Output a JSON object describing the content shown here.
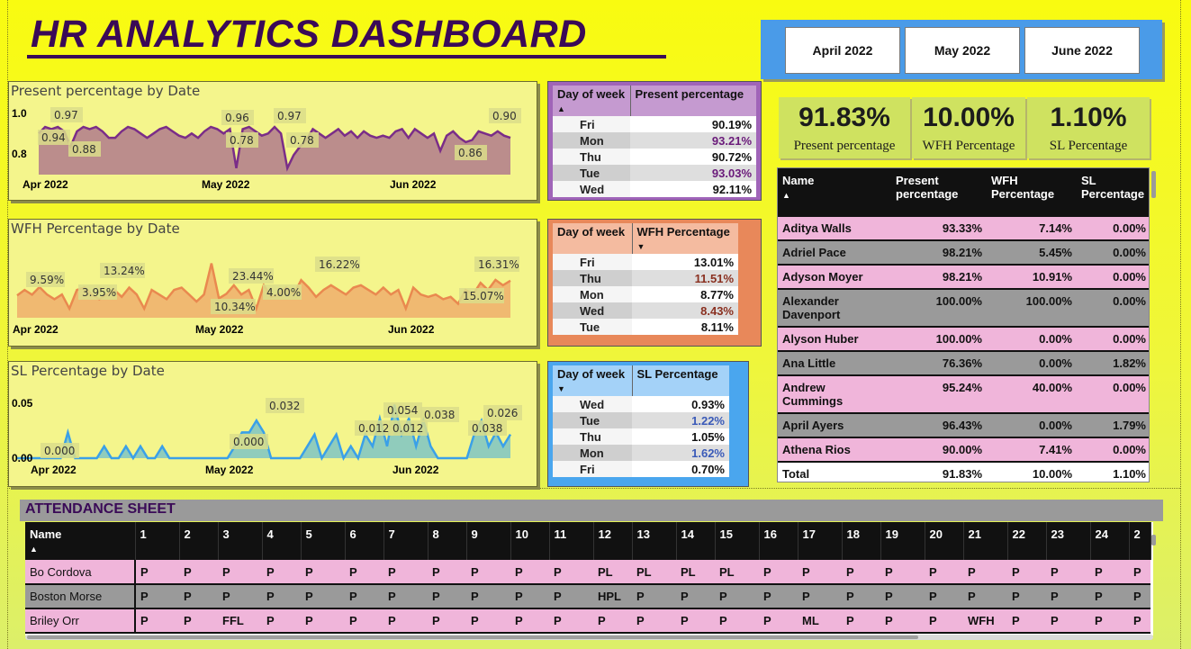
{
  "dashboard_title": "HR ANALYTICS DASHBOARD",
  "colors": {
    "title": "#3a0a57",
    "present_line": "#7a2d88",
    "present_fill": "#b07a8c",
    "wfh_line": "#e9894f",
    "wfh_fill": "#efae6c",
    "sl_line": "#3aa0e8",
    "sl_fill": "#7ec4c4",
    "pink_row": "#f0b5da",
    "grey_row": "#9a9a9a"
  },
  "months": [
    "April 2022",
    "May 2022",
    "June 2022"
  ],
  "kpis": [
    {
      "value": "91.83%",
      "label": "Present percentage"
    },
    {
      "value": "10.00%",
      "label": "WFH Percentage"
    },
    {
      "value": "1.10%",
      "label": "SL Percentage"
    }
  ],
  "chart_data": [
    {
      "type": "area",
      "title": "Present percentage by Date",
      "y_ticks": [
        "1.0",
        "0.8"
      ],
      "x_ticks": [
        "Apr 2022",
        "May 2022",
        "Jun 2022"
      ],
      "ylim": [
        0.75,
        1.02
      ],
      "values": [
        0.94,
        0.97,
        0.96,
        0.97,
        0.95,
        0.88,
        0.95,
        0.97,
        0.96,
        0.97,
        0.95,
        0.92,
        0.92,
        0.95,
        0.97,
        0.96,
        0.94,
        0.92,
        0.94,
        0.96,
        0.97,
        0.95,
        0.93,
        0.92,
        0.94,
        0.92,
        0.95,
        0.97,
        0.96,
        0.94,
        0.96,
        0.78,
        0.96,
        0.97,
        0.95,
        0.93,
        0.94,
        0.97,
        0.94,
        0.78,
        0.84,
        0.88,
        0.91,
        0.96,
        0.94,
        0.92,
        0.94,
        0.96,
        0.93,
        0.95,
        0.92,
        0.95,
        0.93,
        0.92,
        0.93,
        0.92,
        0.95,
        0.96,
        0.92,
        0.96,
        0.94,
        0.92,
        0.94,
        0.86,
        0.93,
        0.95,
        0.92,
        0.9,
        0.91,
        0.95,
        0.94,
        0.93,
        0.95,
        0.93,
        0.92
      ],
      "labels": [
        "0.97",
        "0.94",
        "0.88",
        "0.96",
        "0.78",
        "0.97",
        "0.78",
        "0.90",
        "0.86"
      ]
    },
    {
      "type": "area",
      "title": "WFH Percentage by Date",
      "x_ticks": [
        "Apr 2022",
        "May 2022",
        "Jun 2022"
      ],
      "ylim": [
        0.0,
        0.26
      ],
      "values": [
        0.0959,
        0.12,
        0.0995,
        0.1324,
        0.1,
        0.08,
        0.1,
        0.0395,
        0.12,
        0.13,
        0.1,
        0.08,
        0.1,
        0.12,
        0.09,
        0.13,
        0.1,
        0.0395,
        0.12,
        0.1,
        0.08,
        0.12,
        0.13,
        0.1,
        0.07,
        0.1,
        0.2344,
        0.0834,
        0.1034,
        0.14,
        0.1,
        0.12,
        0.04,
        0.14,
        0.09,
        0.1,
        0.13,
        0.1,
        0.1622,
        0.13,
        0.09,
        0.12,
        0.14,
        0.12,
        0.1,
        0.13,
        0.14,
        0.12,
        0.1,
        0.13,
        0.1,
        0.12,
        0.04,
        0.13,
        0.1,
        0.09,
        0.1,
        0.08,
        0.09,
        0.06,
        0.12,
        0.1,
        0.1507,
        0.12,
        0.1631,
        0.14,
        0.16
      ],
      "labels": [
        "9.59%",
        "3.95%",
        "13.24%",
        "10.34%",
        "23.44%",
        "4.00%",
        "16.22%",
        "16.31%",
        "15.07%"
      ]
    },
    {
      "type": "area",
      "title": "SL Percentage by Date",
      "y_ticks": [
        "0.05",
        "0.00"
      ],
      "x_ticks": [
        "Apr 2022",
        "May 2022",
        "Jun 2022"
      ],
      "ylim": [
        0.0,
        0.06
      ],
      "values": [
        0,
        0,
        0,
        0,
        0,
        0,
        0,
        0.026,
        0,
        0,
        0,
        0,
        0.012,
        0,
        0,
        0.012,
        0,
        0.012,
        0,
        0,
        0.012,
        0,
        0,
        0,
        0,
        0,
        0,
        0,
        0,
        0,
        0.012,
        0.026,
        0.026,
        0.038,
        0.026,
        0,
        0,
        0,
        0,
        0,
        0.012,
        0.024,
        0,
        0.012,
        0.024,
        0,
        0.012,
        0,
        0.024,
        0.012,
        0.04,
        0.012,
        0.054,
        0.024,
        0.04,
        0.012,
        0.038,
        0.012,
        0,
        0,
        0,
        0,
        0,
        0.024,
        0.038,
        0.012,
        0.026,
        0.012,
        0.024
      ],
      "labels": [
        "0.000",
        "0.032",
        "0.000",
        "0.012",
        "0.054",
        "0.012",
        "0.038",
        "0.026",
        "0.038"
      ]
    }
  ],
  "present_table": {
    "h1": "Day of week",
    "h2": "Present percentage",
    "rows": [
      [
        "Fri",
        "90.19%"
      ],
      [
        "Mon",
        "93.21%"
      ],
      [
        "Thu",
        "90.72%"
      ],
      [
        "Tue",
        "93.03%"
      ],
      [
        "Wed",
        "92.11%"
      ]
    ]
  },
  "wfh_table": {
    "h1": "Day of week",
    "h2": "WFH Percentage",
    "rows": [
      [
        "Fri",
        "13.01%"
      ],
      [
        "Thu",
        "11.51%"
      ],
      [
        "Mon",
        "8.77%"
      ],
      [
        "Wed",
        "8.43%"
      ],
      [
        "Tue",
        "8.11%"
      ]
    ]
  },
  "sl_table": {
    "h1": "Day of week",
    "h2": "SL Percentage",
    "rows": [
      [
        "Wed",
        "0.93%"
      ],
      [
        "Tue",
        "1.22%"
      ],
      [
        "Thu",
        "1.05%"
      ],
      [
        "Mon",
        "1.62%"
      ],
      [
        "Fri",
        "0.70%"
      ]
    ]
  },
  "employee_table": {
    "headers": [
      "Name",
      "Present percentage",
      "WFH Percentage",
      "SL Percentage"
    ],
    "rows": [
      [
        "Aditya Walls",
        "93.33%",
        "7.14%",
        "0.00%"
      ],
      [
        "Adriel Pace",
        "98.21%",
        "5.45%",
        "0.00%"
      ],
      [
        "Adyson Moyer",
        "98.21%",
        "10.91%",
        "0.00%"
      ],
      [
        "Alexander Davenport",
        "100.00%",
        "100.00%",
        "0.00%"
      ],
      [
        "Alyson Huber",
        "100.00%",
        "0.00%",
        "0.00%"
      ],
      [
        "Ana Little",
        "76.36%",
        "0.00%",
        "1.82%"
      ],
      [
        "Andrew Cummings",
        "95.24%",
        "40.00%",
        "0.00%"
      ],
      [
        "April Ayers",
        "96.43%",
        "0.00%",
        "1.79%"
      ],
      [
        "Athena Rios",
        "90.00%",
        "7.41%",
        "0.00%"
      ]
    ],
    "total": [
      "Total",
      "91.83%",
      "10.00%",
      "1.10%"
    ]
  },
  "attendance": {
    "title": "ATTENDANCE SHEET",
    "name_header": "Name",
    "days": [
      "1",
      "2",
      "3",
      "4",
      "5",
      "6",
      "7",
      "8",
      "9",
      "10",
      "11",
      "12",
      "13",
      "14",
      "15",
      "16",
      "17",
      "18",
      "19",
      "20",
      "21",
      "22",
      "23",
      "24",
      "2"
    ],
    "rows": [
      {
        "name": "Bo Cordova",
        "marks": [
          "P",
          "P",
          "P",
          "P",
          "P",
          "P",
          "P",
          "P",
          "P",
          "P",
          "P",
          "PL",
          "PL",
          "PL",
          "PL",
          "P",
          "P",
          "P",
          "P",
          "P",
          "P",
          "P",
          "P",
          "P",
          "P"
        ]
      },
      {
        "name": "Boston Morse",
        "marks": [
          "P",
          "P",
          "P",
          "P",
          "P",
          "P",
          "P",
          "P",
          "P",
          "P",
          "P",
          "HPL",
          "P",
          "P",
          "P",
          "P",
          "P",
          "P",
          "P",
          "P",
          "P",
          "P",
          "P",
          "P",
          "P"
        ]
      },
      {
        "name": "Briley Orr",
        "marks": [
          "P",
          "P",
          "FFL",
          "P",
          "P",
          "P",
          "P",
          "P",
          "P",
          "P",
          "P",
          "P",
          "P",
          "P",
          "P",
          "P",
          "ML",
          "P",
          "P",
          "P",
          "WFH",
          "P",
          "P",
          "P",
          "P"
        ]
      }
    ]
  }
}
